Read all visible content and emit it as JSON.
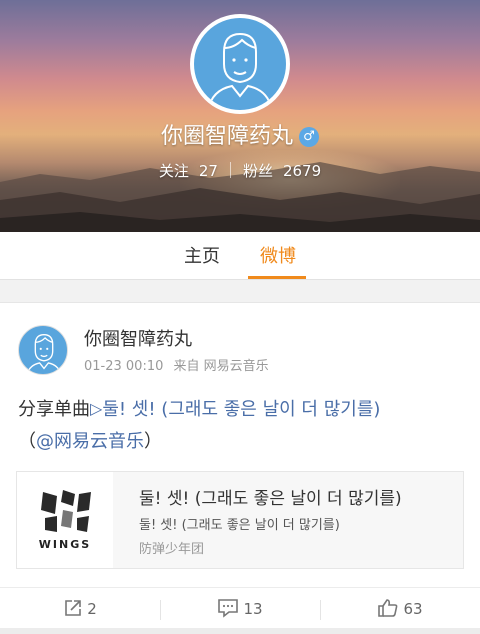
{
  "profile": {
    "name": "你圈智障药丸",
    "gender_symbol": "♂",
    "following_label": "关注",
    "following_count": "27",
    "followers_label": "粉丝",
    "followers_count": "2679"
  },
  "tabs": [
    {
      "label": "主页",
      "active": false
    },
    {
      "label": "微博",
      "active": true
    }
  ],
  "colors": {
    "accent": "#f08a1c",
    "link": "#4a6ea8",
    "avatar_bg": "#59a5dd"
  },
  "post": {
    "author": "你圈智障药丸",
    "time": "01-23 00:10",
    "source_prefix": "来自",
    "source": "网易云音乐",
    "text_prefix": "分享单曲",
    "song_link": "둘! 셋! (그래도 좋은 날이 더 많기를)",
    "open_paren": "（",
    "mention": "@网易云音乐",
    "close_paren": "）",
    "music": {
      "album_label": "WINGS",
      "title": "둘! 셋! (그래도 좋은 날이 더 많기를)",
      "subtitle": "둘! 셋! (그래도 좋은 날이 더 많기를)",
      "artist": "防弹少年团"
    },
    "actions": {
      "repost_count": "2",
      "comment_count": "13",
      "like_count": "63"
    }
  }
}
